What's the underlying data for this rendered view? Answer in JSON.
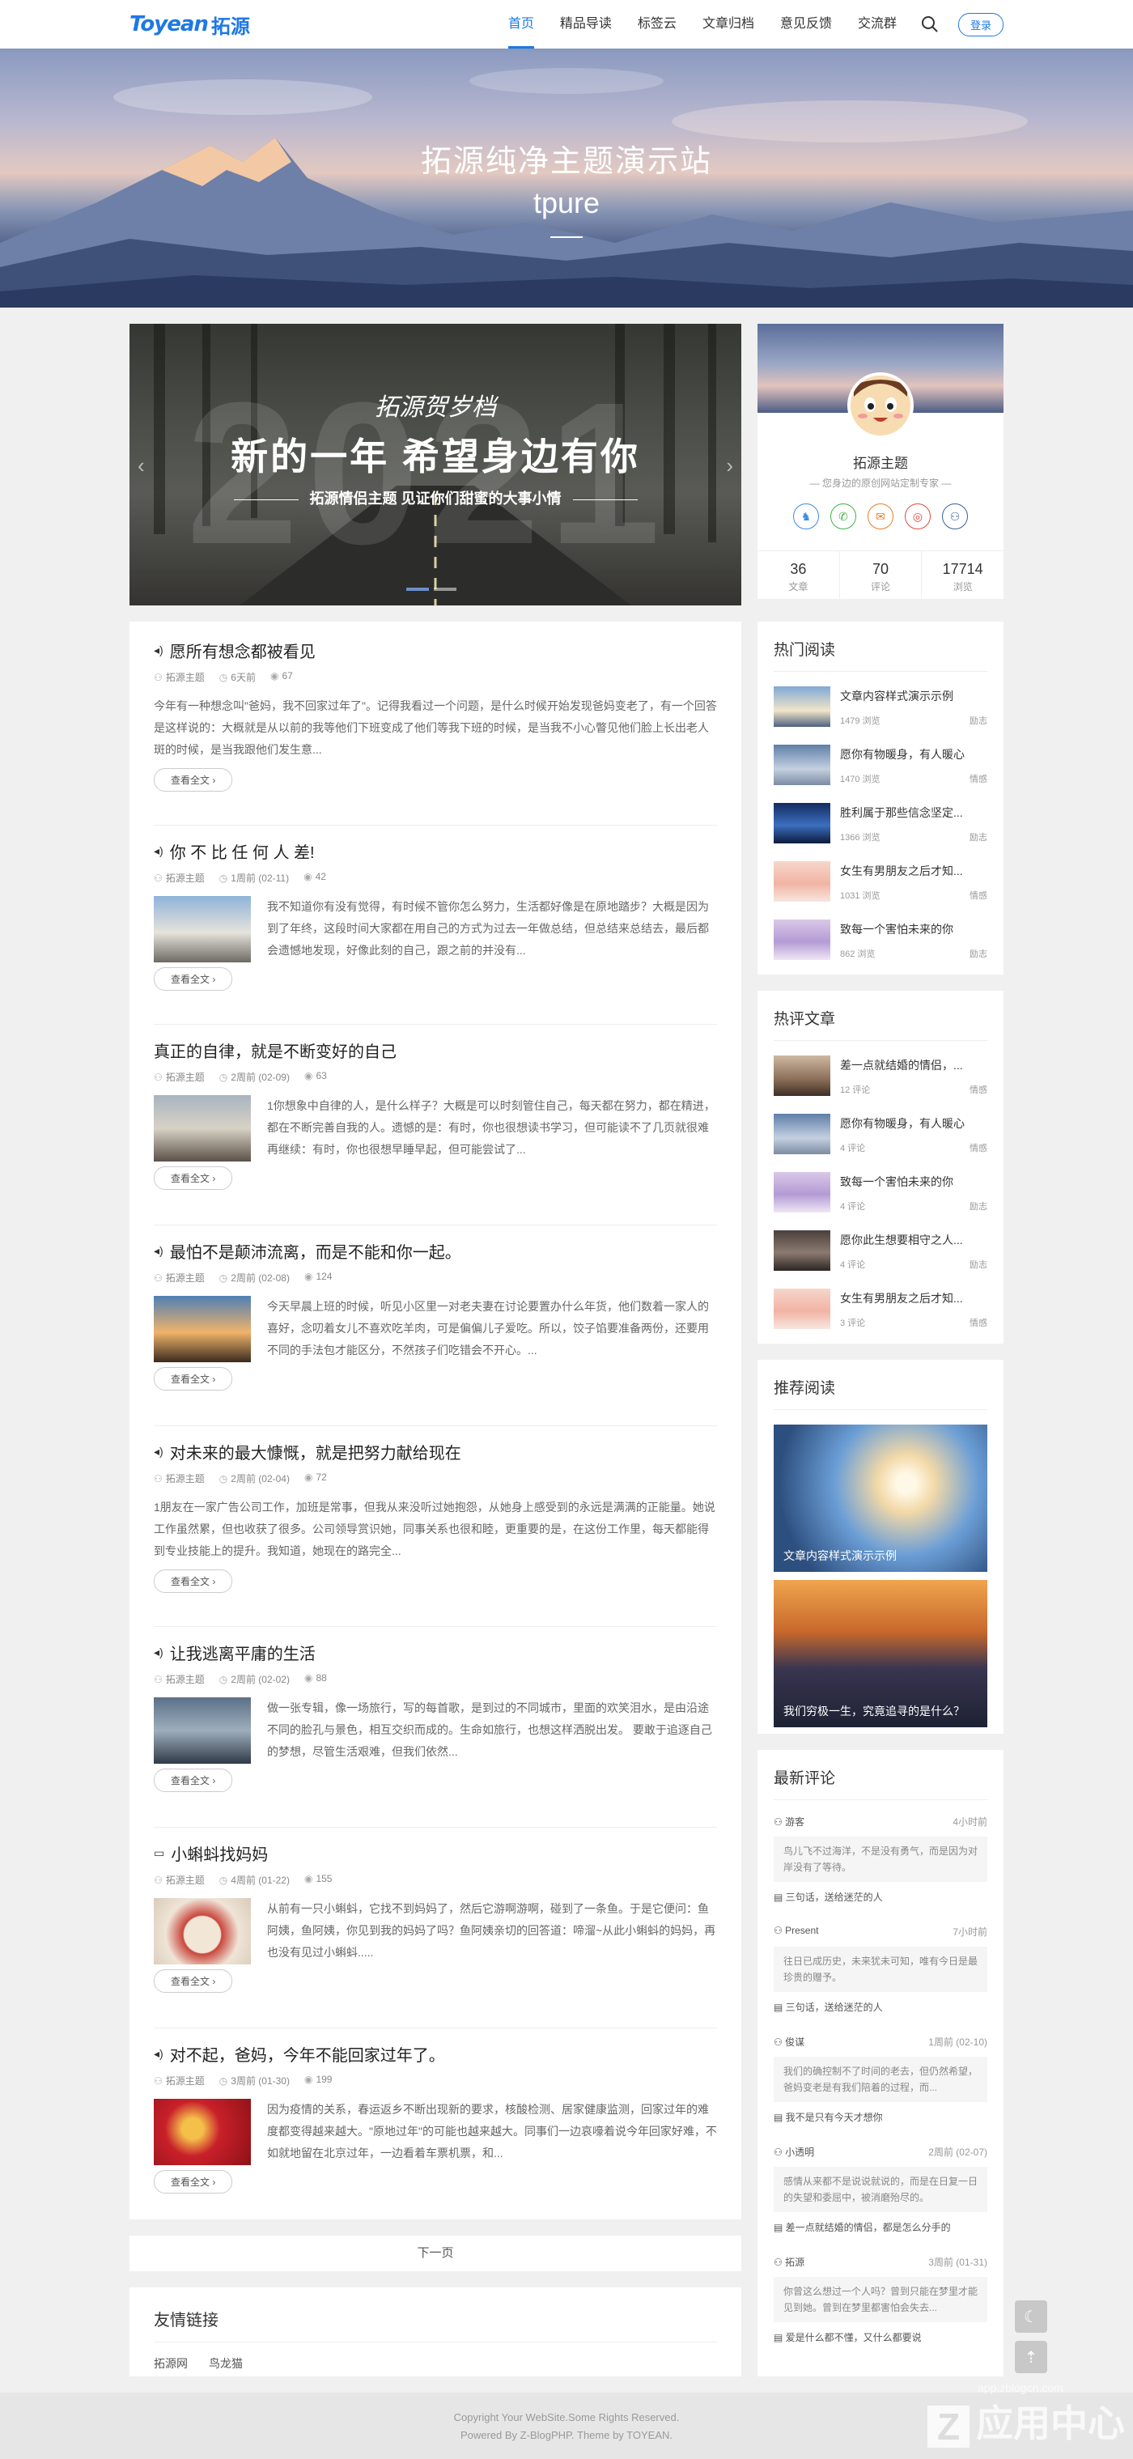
{
  "header": {
    "logo_en": "Toyean",
    "logo_cn": "拓源",
    "nav": [
      {
        "label": "首页",
        "active": true
      },
      {
        "label": "精品导读"
      },
      {
        "label": "标签云"
      },
      {
        "label": "文章归档"
      },
      {
        "label": "意见反馈"
      },
      {
        "label": "交流群"
      }
    ],
    "login": "登录"
  },
  "banner": {
    "title": "拓源纯净主题演示站",
    "subtitle": "tpure"
  },
  "slider": {
    "big_text": "2021",
    "script_text": "拓源贺岁档",
    "headline": "新的一年 希望身边有你",
    "subline": "拓源情侣主题 见证你们甜蜜的大事小情",
    "prev": "‹",
    "next": "›"
  },
  "posts": [
    {
      "title": "愿所有想念都被看见",
      "icon": "audio",
      "author": "拓源主题",
      "time": "6天前",
      "views": "67",
      "excerpt": "今年有一种想念叫\"爸妈，我不回家过年了\"。记得我看过一个问题，是什么时候开始发现爸妈变老了，有一个回答是这样说的：大概就是从以前的我等他们下班变成了他们等我下班的时候，是当我不小心瞥见他们脸上长出老人斑的时候，是当我跟他们发生意...",
      "more": "查看全文 ›",
      "thumb": false
    },
    {
      "title": "你 不 比 任 何 人 差!",
      "icon": "audio",
      "author": "拓源主题",
      "time": "1周前 (02-11)",
      "views": "42",
      "excerpt": "我不知道你有没有觉得，有时候不管你怎么努力，生活都好像是在原地踏步？大概是因为到了年终，这段时间大家都在用自己的方式为过去一年做总结，但总结来总结去，最后都会遗憾地发现，好像此刻的自己，跟之前的并没有...",
      "more": "查看全文 ›",
      "thumb": true
    },
    {
      "title": "真正的自律，就是不断变好的自己",
      "icon": "",
      "author": "拓源主题",
      "time": "2周前 (02-09)",
      "views": "63",
      "excerpt": "1你想象中自律的人，是什么样子？大概是可以时刻管住自己，每天都在努力，都在精进，都在不断完善自我的人。遗憾的是：有时，你也很想读书学习，但可能读不了几页就很难再继续：有时，你也很想早睡早起，但可能尝试了...",
      "more": "查看全文 ›",
      "thumb": true
    },
    {
      "title": "最怕不是颠沛流离，而是不能和你一起。",
      "icon": "audio",
      "author": "拓源主题",
      "time": "2周前 (02-08)",
      "views": "124",
      "excerpt": "今天早晨上班的时候，听见小区里一对老夫妻在讨论要置办什么年货，他们数着一家人的喜好，念叨着女儿不喜欢吃羊肉，可是偏偏儿子爱吃。所以，饺子馅要准备两份，还要用不同的手法包才能区分，不然孩子们吃错会不开心。...",
      "more": "查看全文 ›",
      "thumb": true
    },
    {
      "title": "对未来的最大慷慨，就是把努力献给现在",
      "icon": "audio",
      "author": "拓源主题",
      "time": "2周前 (02-04)",
      "views": "72",
      "excerpt": "1朋友在一家广告公司工作，加班是常事，但我从来没听过她抱怨，从她身上感受到的永远是满满的正能量。她说工作虽然累，但也收获了很多。公司领导赏识她，同事关系也很和睦，更重要的是，在这份工作里，每天都能得到专业技能上的提升。我知道，她现在的路完全...",
      "more": "查看全文 ›",
      "thumb": false
    },
    {
      "title": "让我逃离平庸的生活",
      "icon": "audio",
      "author": "拓源主题",
      "time": "2周前 (02-02)",
      "views": "88",
      "excerpt": "做一张专辑，像一场旅行，写的每首歌，是到过的不同城市，里面的欢笑泪水，是由沿途不同的脸孔与景色，相互交织而成的。生命如旅行，也想这样洒脱出发。 要敢于追逐自己的梦想，尽管生活艰难，但我们依然...",
      "more": "查看全文 ›",
      "thumb": true
    },
    {
      "title": "小蝌蚪找妈妈",
      "icon": "video",
      "author": "拓源主题",
      "time": "4周前 (01-22)",
      "views": "155",
      "excerpt": "从前有一只小蝌蚪，它找不到妈妈了，然后它游啊游啊，碰到了一条鱼。于是它便问：鱼阿姨，鱼阿姨，你见到我的妈妈了吗？鱼阿姨亲切的回答道：啼溜~从此小蝌蚪的妈妈，再也没有见过小蝌蚪.....",
      "more": "查看全文 ›",
      "thumb": true
    },
    {
      "title": "对不起，爸妈，今年不能回家过年了。",
      "icon": "audio",
      "author": "拓源主题",
      "time": "3周前 (01-30)",
      "views": "199",
      "excerpt": "因为疫情的关系，春运返乡不断出现新的要求，核酸检测、居家健康监测，回家过年的难度都变得越来越大。\"原地过年\"的可能也越来越大。同事们一边哀嚎着说今年回家好难，不如就地留在北京过年，一边看着车票机票，和...",
      "more": "查看全文 ›",
      "thumb": true
    }
  ],
  "pager": "下一页",
  "links": {
    "title": "友情链接",
    "items": [
      "拓源网",
      "鸟龙猫"
    ]
  },
  "profile": {
    "name": "拓源主题",
    "desc": "— 您身边的原创网站定制专家 —",
    "stats": [
      {
        "value": "36",
        "label": "文章"
      },
      {
        "value": "70",
        "label": "评论"
      },
      {
        "value": "17714",
        "label": "浏览"
      }
    ]
  },
  "hot": {
    "title": "热门阅读",
    "items": [
      {
        "title": "文章内容样式演示示例",
        "views": "1479 浏览",
        "cat": "励志"
      },
      {
        "title": "愿你有物暖身，有人暖心",
        "views": "1470 浏览",
        "cat": "情感"
      },
      {
        "title": "胜利属于那些信念坚定...",
        "views": "1366 浏览",
        "cat": "励志"
      },
      {
        "title": "女生有男朋友之后才知...",
        "views": "1031 浏览",
        "cat": "情感"
      },
      {
        "title": "致每一个害怕未来的你",
        "views": "862 浏览",
        "cat": "励志"
      }
    ]
  },
  "commented": {
    "title": "热评文章",
    "items": [
      {
        "title": "差一点就结婚的情侣，...",
        "views": "12 评论",
        "cat": "情感"
      },
      {
        "title": "愿你有物暖身，有人暖心",
        "views": "4 评论",
        "cat": "情感"
      },
      {
        "title": "致每一个害怕未来的你",
        "views": "4 评论",
        "cat": "励志"
      },
      {
        "title": "愿你此生想要相守之人...",
        "views": "4 评论",
        "cat": "励志"
      },
      {
        "title": "女生有男朋友之后才知...",
        "views": "3 评论",
        "cat": "情感"
      }
    ]
  },
  "recommend": {
    "title": "推荐阅读",
    "items": [
      {
        "caption": "文章内容样式演示示例"
      },
      {
        "caption": "我们穷极一生，究竟追寻的是什么？"
      }
    ]
  },
  "comments": {
    "title": "最新评论",
    "items": [
      {
        "user": "游客",
        "time": "4小时前",
        "text": "鸟儿飞不过海洋，不是没有勇气，而是因为对岸没有了等待。",
        "post": "三句话，送给迷茫的人"
      },
      {
        "user": "Present",
        "time": "7小时前",
        "text": "往日已成历史，未来犹未可知，唯有今日是最珍贵的赠予。",
        "post": "三句话，送给迷茫的人"
      },
      {
        "user": "俊谋",
        "time": "1周前 (02-10)",
        "text": "我们的确控制不了时间的老去，但仍然希望，爸妈变老是有我们陪着的过程，而...",
        "post": "我不是只有今天才想你"
      },
      {
        "user": "小透明",
        "time": "2周前 (02-07)",
        "text": "感情从来都不是说说就说的，而是在日复一日的失望和委屈中，被消磨殆尽的。",
        "post": "差一点就结婚的情侣，都是怎么分手的"
      },
      {
        "user": "拓源",
        "time": "3周前 (01-31)",
        "text": "你曾这么想过一个人吗？曾到只能在梦里才能见到她。曾到在梦里都害怕会失去...",
        "post": "爱是什么都不懂，又什么都要说"
      }
    ]
  },
  "footer": {
    "line1": "Copyright Your WebSite.Some Rights Reserved.",
    "line2": "Powered By Z-BlogPHP. Theme by TOYEAN."
  },
  "watermark": {
    "url": "app.zblogcn.com",
    "text": "应用中心",
    "mark": "Z"
  },
  "colors": {
    "accent": "#1e78e6"
  }
}
